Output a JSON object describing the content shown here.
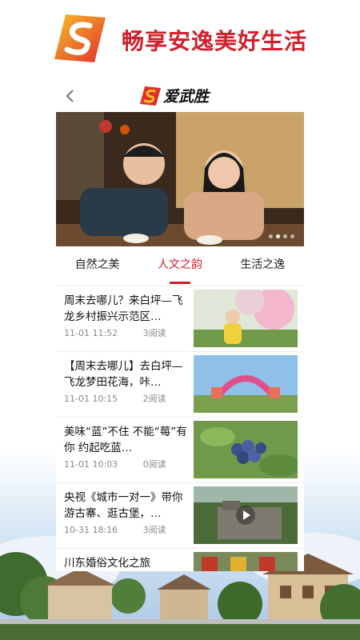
{
  "promo": {
    "slogan": "畅享安逸美好生活"
  },
  "app": {
    "title": "爱武胜"
  },
  "tabs": [
    {
      "label": "自然之美",
      "active": false
    },
    {
      "label": "人文之韵",
      "active": true
    },
    {
      "label": "生活之逸",
      "active": false
    }
  ],
  "banner": {
    "slides": 4,
    "current": 1
  },
  "news": [
    {
      "title": "周末去哪儿？来白坪—飞龙乡村振兴示范区…",
      "date": "11-01 11:52",
      "reads": "3阅读",
      "thumb": "flower-girl"
    },
    {
      "title": "【周末去哪儿】去白坪—飞龙梦田花海，咔…",
      "date": "11-01 10:15",
      "reads": "2阅读",
      "thumb": "gate"
    },
    {
      "title": "美味“蓝”不住 不能“莓”有你 约起吃蓝…",
      "date": "11-01 10:03",
      "reads": "0阅读",
      "thumb": "blueberry"
    },
    {
      "title": "央视《城市一对一》带你游古寨、逛古堡，…",
      "date": "10-31 18:16",
      "reads": "3阅读",
      "thumb": "video-fort"
    },
    {
      "title": "川东婚俗文化之旅",
      "date": "",
      "reads": "",
      "thumb": "wedding"
    }
  ],
  "colors": {
    "brand": "#d1202b",
    "text": "#111111",
    "meta": "#888888"
  }
}
